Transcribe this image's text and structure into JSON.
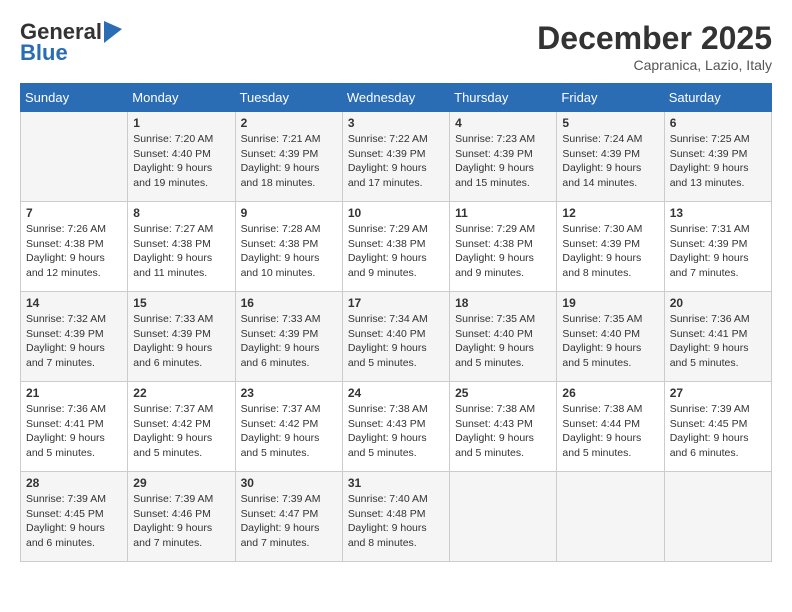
{
  "header": {
    "logo_line1": "General",
    "logo_line2": "Blue",
    "month_title": "December 2025",
    "subtitle": "Capranica, Lazio, Italy"
  },
  "days_of_week": [
    "Sunday",
    "Monday",
    "Tuesday",
    "Wednesday",
    "Thursday",
    "Friday",
    "Saturday"
  ],
  "weeks": [
    [
      {
        "day": "",
        "info": ""
      },
      {
        "day": "1",
        "info": "Sunrise: 7:20 AM\nSunset: 4:40 PM\nDaylight: 9 hours\nand 19 minutes."
      },
      {
        "day": "2",
        "info": "Sunrise: 7:21 AM\nSunset: 4:39 PM\nDaylight: 9 hours\nand 18 minutes."
      },
      {
        "day": "3",
        "info": "Sunrise: 7:22 AM\nSunset: 4:39 PM\nDaylight: 9 hours\nand 17 minutes."
      },
      {
        "day": "4",
        "info": "Sunrise: 7:23 AM\nSunset: 4:39 PM\nDaylight: 9 hours\nand 15 minutes."
      },
      {
        "day": "5",
        "info": "Sunrise: 7:24 AM\nSunset: 4:39 PM\nDaylight: 9 hours\nand 14 minutes."
      },
      {
        "day": "6",
        "info": "Sunrise: 7:25 AM\nSunset: 4:39 PM\nDaylight: 9 hours\nand 13 minutes."
      }
    ],
    [
      {
        "day": "7",
        "info": "Sunrise: 7:26 AM\nSunset: 4:38 PM\nDaylight: 9 hours\nand 12 minutes."
      },
      {
        "day": "8",
        "info": "Sunrise: 7:27 AM\nSunset: 4:38 PM\nDaylight: 9 hours\nand 11 minutes."
      },
      {
        "day": "9",
        "info": "Sunrise: 7:28 AM\nSunset: 4:38 PM\nDaylight: 9 hours\nand 10 minutes."
      },
      {
        "day": "10",
        "info": "Sunrise: 7:29 AM\nSunset: 4:38 PM\nDaylight: 9 hours\nand 9 minutes."
      },
      {
        "day": "11",
        "info": "Sunrise: 7:29 AM\nSunset: 4:38 PM\nDaylight: 9 hours\nand 9 minutes."
      },
      {
        "day": "12",
        "info": "Sunrise: 7:30 AM\nSunset: 4:39 PM\nDaylight: 9 hours\nand 8 minutes."
      },
      {
        "day": "13",
        "info": "Sunrise: 7:31 AM\nSunset: 4:39 PM\nDaylight: 9 hours\nand 7 minutes."
      }
    ],
    [
      {
        "day": "14",
        "info": "Sunrise: 7:32 AM\nSunset: 4:39 PM\nDaylight: 9 hours\nand 7 minutes."
      },
      {
        "day": "15",
        "info": "Sunrise: 7:33 AM\nSunset: 4:39 PM\nDaylight: 9 hours\nand 6 minutes."
      },
      {
        "day": "16",
        "info": "Sunrise: 7:33 AM\nSunset: 4:39 PM\nDaylight: 9 hours\nand 6 minutes."
      },
      {
        "day": "17",
        "info": "Sunrise: 7:34 AM\nSunset: 4:40 PM\nDaylight: 9 hours\nand 5 minutes."
      },
      {
        "day": "18",
        "info": "Sunrise: 7:35 AM\nSunset: 4:40 PM\nDaylight: 9 hours\nand 5 minutes."
      },
      {
        "day": "19",
        "info": "Sunrise: 7:35 AM\nSunset: 4:40 PM\nDaylight: 9 hours\nand 5 minutes."
      },
      {
        "day": "20",
        "info": "Sunrise: 7:36 AM\nSunset: 4:41 PM\nDaylight: 9 hours\nand 5 minutes."
      }
    ],
    [
      {
        "day": "21",
        "info": "Sunrise: 7:36 AM\nSunset: 4:41 PM\nDaylight: 9 hours\nand 5 minutes."
      },
      {
        "day": "22",
        "info": "Sunrise: 7:37 AM\nSunset: 4:42 PM\nDaylight: 9 hours\nand 5 minutes."
      },
      {
        "day": "23",
        "info": "Sunrise: 7:37 AM\nSunset: 4:42 PM\nDaylight: 9 hours\nand 5 minutes."
      },
      {
        "day": "24",
        "info": "Sunrise: 7:38 AM\nSunset: 4:43 PM\nDaylight: 9 hours\nand 5 minutes."
      },
      {
        "day": "25",
        "info": "Sunrise: 7:38 AM\nSunset: 4:43 PM\nDaylight: 9 hours\nand 5 minutes."
      },
      {
        "day": "26",
        "info": "Sunrise: 7:38 AM\nSunset: 4:44 PM\nDaylight: 9 hours\nand 5 minutes."
      },
      {
        "day": "27",
        "info": "Sunrise: 7:39 AM\nSunset: 4:45 PM\nDaylight: 9 hours\nand 6 minutes."
      }
    ],
    [
      {
        "day": "28",
        "info": "Sunrise: 7:39 AM\nSunset: 4:45 PM\nDaylight: 9 hours\nand 6 minutes."
      },
      {
        "day": "29",
        "info": "Sunrise: 7:39 AM\nSunset: 4:46 PM\nDaylight: 9 hours\nand 7 minutes."
      },
      {
        "day": "30",
        "info": "Sunrise: 7:39 AM\nSunset: 4:47 PM\nDaylight: 9 hours\nand 7 minutes."
      },
      {
        "day": "31",
        "info": "Sunrise: 7:40 AM\nSunset: 4:48 PM\nDaylight: 9 hours\nand 8 minutes."
      },
      {
        "day": "",
        "info": ""
      },
      {
        "day": "",
        "info": ""
      },
      {
        "day": "",
        "info": ""
      }
    ]
  ]
}
